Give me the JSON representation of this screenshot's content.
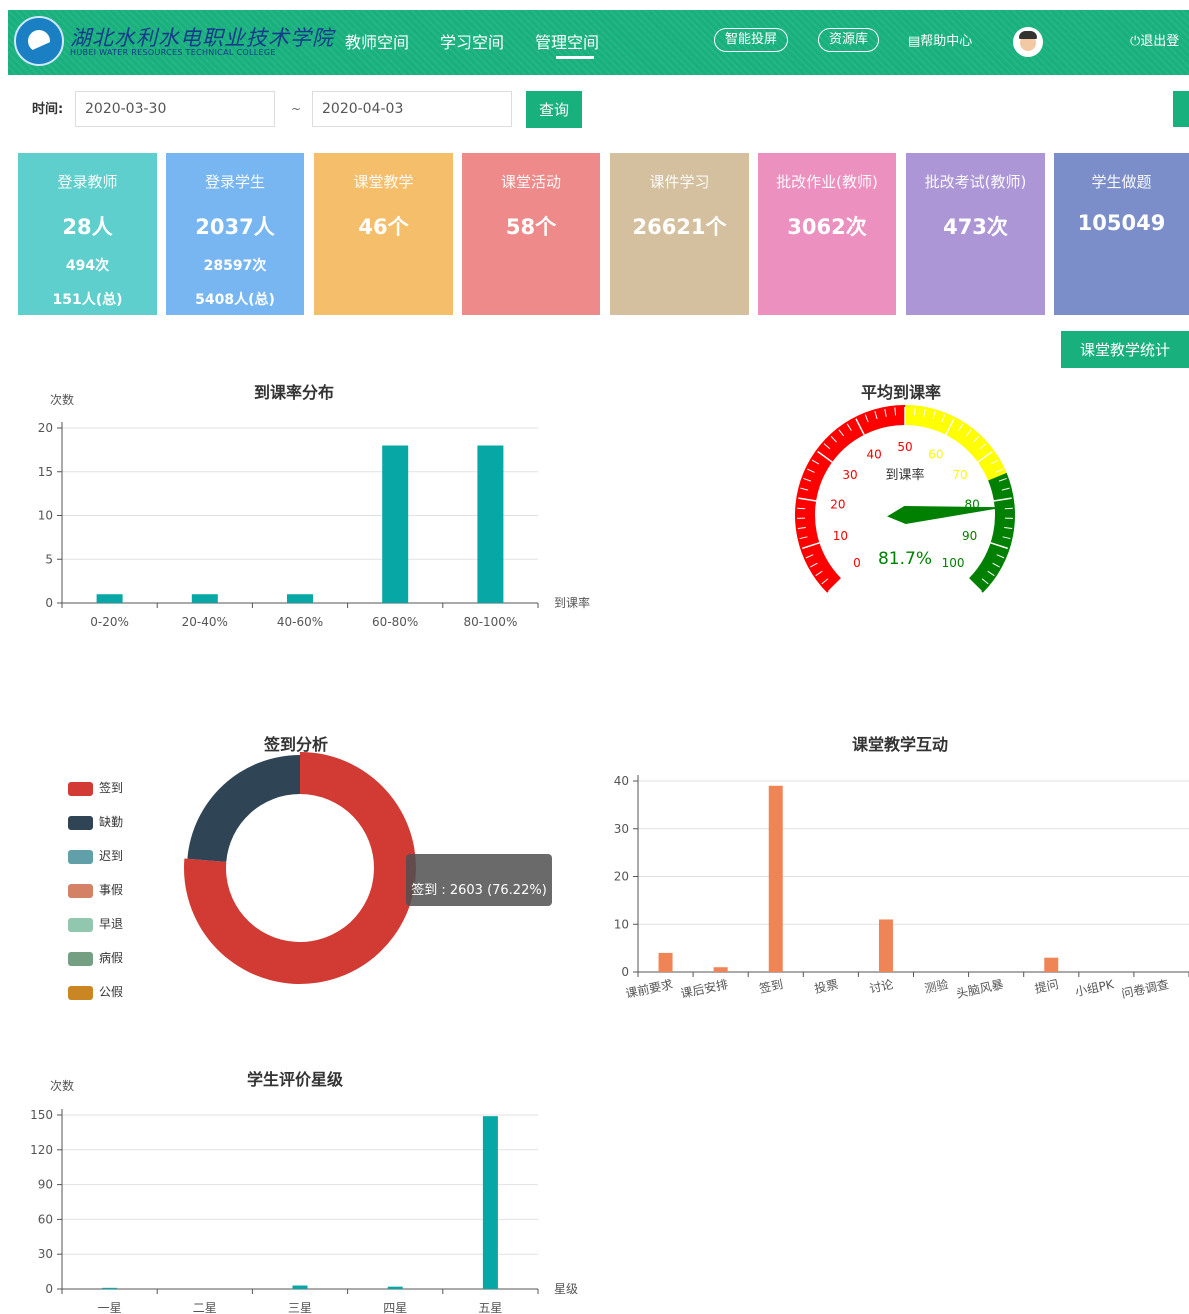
{
  "header": {
    "logo_text": "湖北水利水电职业技术学院",
    "logo_subtext": "HUBEI WATER RESOURCES TECHNICAL COLLEGE",
    "nav": [
      "教师空间",
      "学习空间",
      "管理空间"
    ],
    "active_nav": "管理空间",
    "pills": [
      "智能投屏",
      "资源库"
    ],
    "help": "帮助中心",
    "logout": "退出登"
  },
  "filter": {
    "time_label": "时间:",
    "start_date": "2020-03-30",
    "separator": "~",
    "end_date": "2020-04-03",
    "query_label": "查询"
  },
  "cards": [
    {
      "title": "登录教师",
      "value": "28人",
      "sub1": "494次",
      "sub2": "151人(总)",
      "color": "#5ecfcc"
    },
    {
      "title": "登录学生",
      "value": "2037人",
      "sub1": "28597次",
      "sub2": "5408人(总)",
      "color": "#78b6f2"
    },
    {
      "title": "课堂教学",
      "value": "46个",
      "sub1": "",
      "sub2": "",
      "color": "#f4be6a"
    },
    {
      "title": "课堂活动",
      "value": "58个",
      "sub1": "",
      "sub2": "",
      "color": "#ef8a8a"
    },
    {
      "title": "课件学习",
      "value": "26621个",
      "sub1": "",
      "sub2": "",
      "color": "#d4bf9e"
    },
    {
      "title": "批改作业(教师)",
      "value": "3062次",
      "sub1": "",
      "sub2": "",
      "color": "#ec90bf"
    },
    {
      "title": "批改考试(教师)",
      "value": "473次",
      "sub1": "",
      "sub2": "",
      "color": "#ac96d6"
    },
    {
      "title": "学生做题",
      "value": "105049",
      "sub1": "",
      "sub2": "",
      "color": "#7b8ec9"
    }
  ],
  "stat_button": "课堂教学统计",
  "chart_data": [
    {
      "type": "bar",
      "title": "到课率分布",
      "ylabel": "次数",
      "xlabel": "到课率",
      "categories": [
        "0-20%",
        "20-40%",
        "40-60%",
        "60-80%",
        "80-100%"
      ],
      "values": [
        1,
        1,
        1,
        18,
        18
      ],
      "ylim": [
        0,
        20
      ],
      "yticks": [
        0,
        5,
        10,
        15,
        20
      ],
      "color": "#06a7a4"
    },
    {
      "type": "gauge",
      "title": "平均到课率",
      "name": "到课率",
      "value": 81.7,
      "value_text": "81.7%",
      "ticks": [
        0,
        10,
        20,
        30,
        40,
        50,
        60,
        70,
        80,
        90,
        100
      ],
      "bands": [
        {
          "to": 50,
          "color": "#ff0000"
        },
        {
          "to": 75,
          "color": "#ffff00"
        },
        {
          "to": 100,
          "color": "#008000"
        }
      ]
    },
    {
      "type": "pie",
      "title": "签到分析",
      "slices": [
        {
          "name": "签到",
          "value": 2603,
          "color": "#d13b33"
        },
        {
          "name": "缺勤",
          "value": 808,
          "color": "#2f4556"
        },
        {
          "name": "迟到",
          "value": 0,
          "color": "#61a0a8"
        },
        {
          "name": "事假",
          "value": 0,
          "color": "#d48265"
        },
        {
          "name": "早退",
          "value": 0,
          "color": "#91c7ae"
        },
        {
          "name": "病假",
          "value": 0,
          "color": "#749f83"
        },
        {
          "name": "公假",
          "value": 0,
          "color": "#ca8622"
        }
      ],
      "tooltip": "签到 : 2603 (76.22%)"
    },
    {
      "type": "bar",
      "title": "课堂教学互动",
      "categories": [
        "课前要求",
        "课后安排",
        "签到",
        "投票",
        "讨论",
        "测验",
        "头脑风暴",
        "提问",
        "小组PK",
        "问卷调查"
      ],
      "values": [
        4,
        1,
        39,
        0,
        11,
        0,
        0,
        3,
        0,
        0
      ],
      "ylim": [
        0,
        40
      ],
      "yticks": [
        0,
        10,
        20,
        30,
        40
      ],
      "color": "#ef8557"
    },
    {
      "type": "bar",
      "title": "学生评价星级",
      "ylabel": "次数",
      "xlabel": "星级",
      "categories": [
        "一星",
        "二星",
        "三星",
        "四星",
        "五星"
      ],
      "values": [
        1,
        0,
        3,
        2,
        149
      ],
      "ylim": [
        0,
        150
      ],
      "yticks": [
        0,
        30,
        60,
        90,
        120,
        150
      ],
      "color": "#06a7a4"
    }
  ]
}
